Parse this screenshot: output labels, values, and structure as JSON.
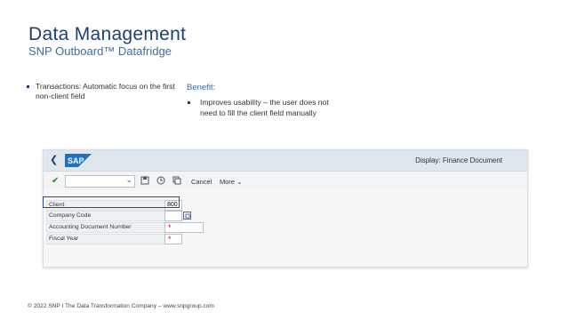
{
  "slide": {
    "title": "Data Management",
    "subtitle": "SNP Outboard™ Datafridge",
    "bullet": "Transactions: Automatic focus on the first non-client field",
    "benefit_heading": "Benefit:",
    "benefit_item": "Improves usability – the user does not need to fill the client field manually",
    "footer": "© 2022 SNP I The Data Transformation Company – www.snpgroup.com"
  },
  "sap": {
    "logo_text": "SAP",
    "window_title": "Display: Finance Document",
    "toolbar": {
      "cancel_label": "Cancel",
      "more_label": "More"
    },
    "form": {
      "client_label": "Client",
      "client_value": "800",
      "company_code_label": "Company Code",
      "company_code_value": "",
      "accounting_doc_label": "Accounting Document Number",
      "accounting_doc_value": "",
      "fiscal_year_label": "Fiscal Year",
      "fiscal_year_value": "",
      "required_marker": "*"
    }
  },
  "colors": {
    "title": "#1f3f6e",
    "accent": "#3e6aa6",
    "sap_blue": "#1a73c7",
    "shell": "#dfe6ee",
    "required": "#c8102e",
    "focus": "#2b4a8a"
  },
  "icons": [
    "back-arrow-icon",
    "checkmark-icon",
    "chevron-down-icon",
    "save-icon",
    "clock-icon",
    "copy-icon",
    "value-help-icon"
  ]
}
